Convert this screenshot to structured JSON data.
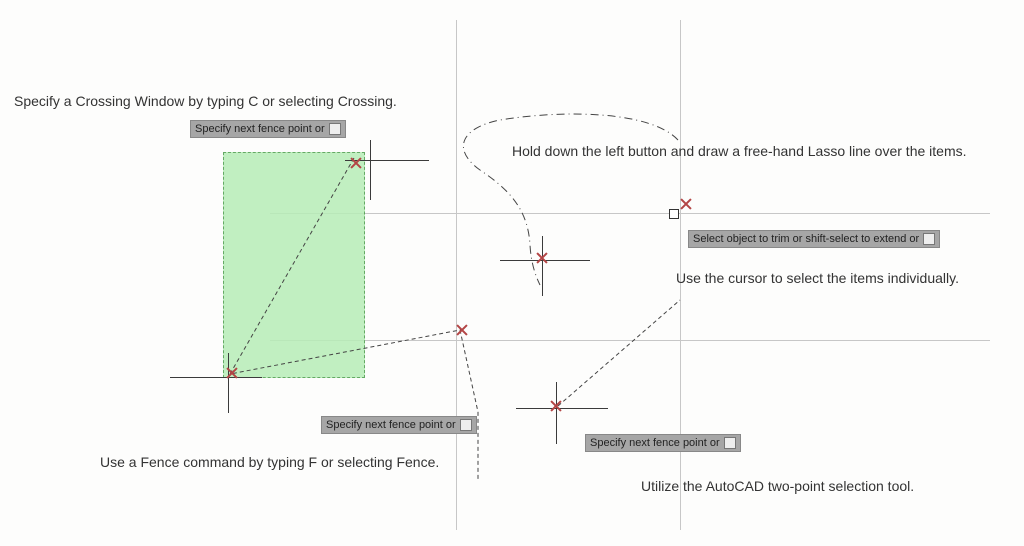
{
  "captions": {
    "crossing": "Specify a Crossing Window by typing C or selecting Crossing.",
    "lasso": "Hold down the left button and draw a free-hand Lasso line over the items.",
    "cursor": "Use the cursor to select the items individually.",
    "fence": "Use a Fence command by typing F or selecting Fence.",
    "twopoint": "Utilize the AutoCAD two-point selection tool."
  },
  "tooltips": {
    "fence_prompt": "Specify next fence point or",
    "trim_prompt": "Select object to trim or shift-select to extend or"
  },
  "colors": {
    "crossing_fill": "#b7edb7",
    "crossing_border": "#4a9b4a",
    "grid": "#c7c7c7",
    "marker": "#b34545"
  }
}
